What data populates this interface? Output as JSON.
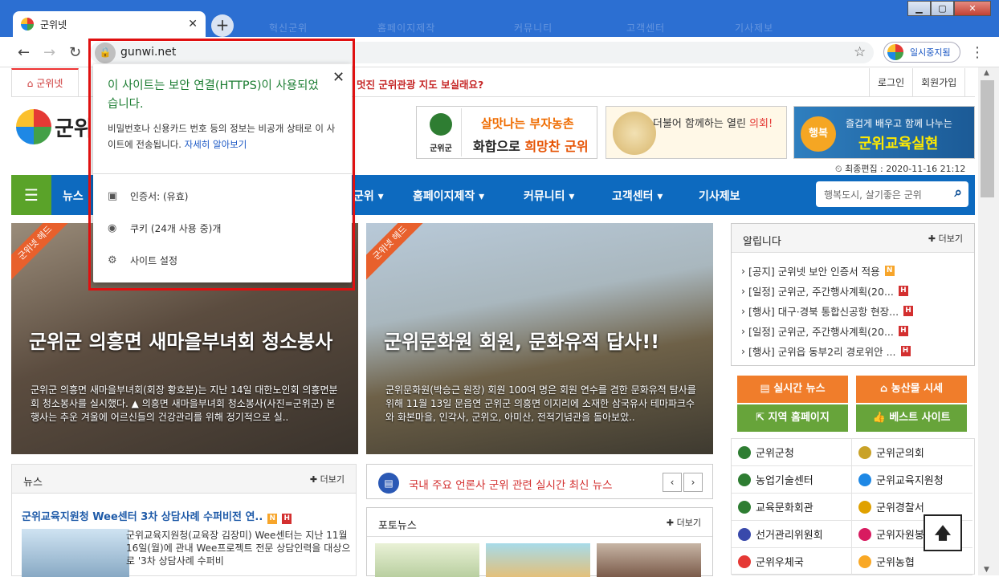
{
  "browser": {
    "tab_title": "군위넷",
    "tab_close": "✕",
    "new_tab": "+",
    "url": "gunwi.net",
    "profile_label": "일시중지됨",
    "ghost_tabs": [
      "혁신군위",
      "홈페이지제작",
      "커뮤니티",
      "고객센터",
      "기사제보"
    ]
  },
  "site": {
    "home_tab": "군위넷",
    "ticker": "멋진 군위관광 지도 보실래요?",
    "login": "로그인",
    "signup": "회원가입",
    "logo_text": "군위",
    "last_edited": "최종편집 : 2020-11-16 21:12"
  },
  "banners": {
    "b1_line1": "살맛나는 부자농촌",
    "b1_line2a": "화합으로 ",
    "b1_line2b": "희망찬 군위",
    "b1_caption": "군위군",
    "b2_text_a": "더불어 함께하는 열린 ",
    "b2_text_b": "의회!",
    "b3_badge": "행복",
    "b3_line1": "즐겁게 배우고 함께 나누는",
    "b3_line2": "군위교육실현"
  },
  "gnb": {
    "items": [
      "뉴스",
      "군위",
      "홈페이지제작",
      "커뮤니티",
      "고객센터",
      "기사제보"
    ],
    "search_placeholder": "행복도시, 살기좋은 군위"
  },
  "hero": [
    {
      "ribbon": "군위넷 헤드",
      "headline": "군위군 의흥면 새마을부녀회 청소봉사",
      "desc": "군위군 의흥면 새마을부녀회(회장 황호분)는 지난 14일 대한노인회 의흥면분회 청소봉사를 실시했다. ▲ 의흥면 새마을부녀회 청소봉사(사진=군위군) 본 행사는 추운 겨울에 어르신들의 건강관리를 위해 정기적으로 실.."
    },
    {
      "ribbon": "군위넷 헤드",
      "headline": "군위문화원 회원, 문화유적 답사!!",
      "desc": "군위문화원(박승근 원장) 회원 100여 명은 회원 연수를 겸한 문화유적 탐사를 위해 11월 13일 문읍연 군위군 의흥면 이지리에 소재한 삼국유사 테마파크수와 화본마을, 인각사, 군위오, 아미산, 전적기념관을 돌아보았.."
    }
  ],
  "notice": {
    "title": "알립니다",
    "more": "✚ 더보기",
    "items": [
      {
        "text": "[공지] 군위넷 보안 인증서 적용",
        "badge": "N"
      },
      {
        "text": "[일정] 군위군, 주간행사계획(20...",
        "badge": "H"
      },
      {
        "text": "[행사] 대구·경북 통합신공항 현장...",
        "badge": "H"
      },
      {
        "text": "[일정] 군위군, 주간행사계획(20...",
        "badge": "H"
      },
      {
        "text": "[행사] 군위읍 동부2리 경로위안 ...",
        "badge": "H"
      }
    ]
  },
  "quick": [
    "▤ 실시간 뉴스",
    "⌂ 농산물 시세",
    "⇱ 지역 홈페이지",
    "👍 베스트 사이트"
  ],
  "links": [
    "군위군청",
    "군위군의회",
    "농업기술센터",
    "군위교육지원청",
    "교육문화회관",
    "군위경찰서",
    "선거관리위원회",
    "군위자원봉사센터",
    "군위우체국",
    "군위농협"
  ],
  "news": {
    "title": "뉴스",
    "more": "✚ 더보기",
    "headline": "군위교육지원청 Wee센터 3차 상담사례 수퍼비전 연..",
    "badges": [
      "N",
      "H"
    ],
    "text": "군위교육지원청(교육장 김장미) Wee센터는 지난 11월 16일(월)에 관내 Wee프로젝트 전문 상담인력을 대상으로 '3차 상담사례 수퍼비"
  },
  "realtime": {
    "text": "국내 주요 언론사 군위 관련 실시간 최신 뉴스",
    "prev": "‹",
    "next": "›"
  },
  "photo": {
    "title": "포토뉴스",
    "more": "✚ 더보기"
  },
  "popup": {
    "title": "이 사이트는 보안 연결(HTTPS)이 사용되었습니다.",
    "desc": "비밀번호나 신용카드 번호 등의 정보는 비공개 상태로 이 사이트에 전송됩니다.",
    "learn_more": "자세히 알아보기",
    "certificate": "인증서: (유효)",
    "cookies": "쿠키 (24개 사용 중)개",
    "site_settings": "사이트 설정",
    "close": "✕"
  }
}
